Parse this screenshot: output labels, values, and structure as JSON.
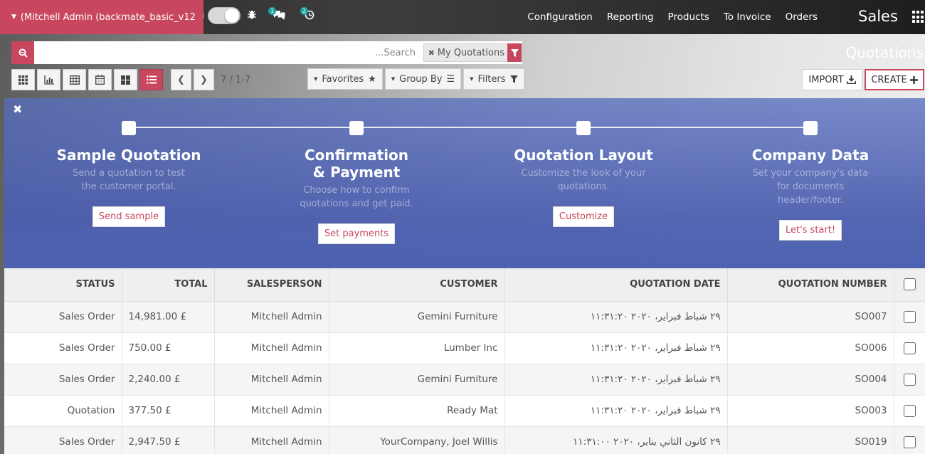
{
  "user": {
    "name": "(Mitchell Admin (backmate_basic_v12"
  },
  "nav": {
    "app_title": "Sales",
    "links": [
      "Configuration",
      "Reporting",
      "Products",
      "To Invoice",
      "Orders"
    ],
    "messages_badge": "1",
    "activity_badge": "2"
  },
  "search": {
    "placeholder": "...Search",
    "facet": "My Quotations"
  },
  "breadcrumb": "Quotations",
  "pager": "7 / 1-7",
  "dropdowns": {
    "favorites": "Favorites",
    "group_by": "Group By",
    "filters": "Filters"
  },
  "actions": {
    "import": "IMPORT",
    "create": "CREATE"
  },
  "onboarding": {
    "steps": [
      {
        "title": "Sample Quotation",
        "desc": "Send a quotation to test the customer portal.",
        "button": "Send sample"
      },
      {
        "title": "Confirmation & Payment",
        "desc": "Choose how to confirm quotations and get paid.",
        "button": "Set payments"
      },
      {
        "title": "Quotation Layout",
        "desc": "Customize the look of your quotations.",
        "button": "Customize"
      },
      {
        "title": "Company Data",
        "desc": "Set your company's data for documents header/footer.",
        "button": "Let's start!"
      }
    ]
  },
  "table": {
    "headers": [
      "STATUS",
      "TOTAL",
      "SALESPERSON",
      "CUSTOMER",
      "QUOTATION DATE",
      "QUOTATION NUMBER"
    ],
    "rows": [
      [
        "Sales Order",
        "14,981.00 £",
        "Mitchell Admin",
        "Gemini Furniture",
        "٢٩ شباط فبراير، ٢٠٢٠ ١١:٣١:٢٠",
        "SO007"
      ],
      [
        "Sales Order",
        "750.00 £",
        "Mitchell Admin",
        "Lumber Inc",
        "٢٩ شباط فبراير، ٢٠٢٠ ١١:٣١:٢٠",
        "SO006"
      ],
      [
        "Sales Order",
        "2,240.00 £",
        "Mitchell Admin",
        "Gemini Furniture",
        "٢٩ شباط فبراير، ٢٠٢٠ ١١:٣١:٢٠",
        "SO004"
      ],
      [
        "Quotation",
        "377.50 £",
        "Mitchell Admin",
        "Ready Mat",
        "٢٩ شباط فبراير، ٢٠٢٠ ١١:٣١:٢٠",
        "SO003"
      ],
      [
        "Sales Order",
        "2,947.50 £",
        "Mitchell Admin",
        "YourCompany, Joel Willis",
        "٢٩ كانون الثاني يناير، ٢٠٢٠ ١١:٣١:٠٠",
        "SO019"
      ]
    ]
  }
}
